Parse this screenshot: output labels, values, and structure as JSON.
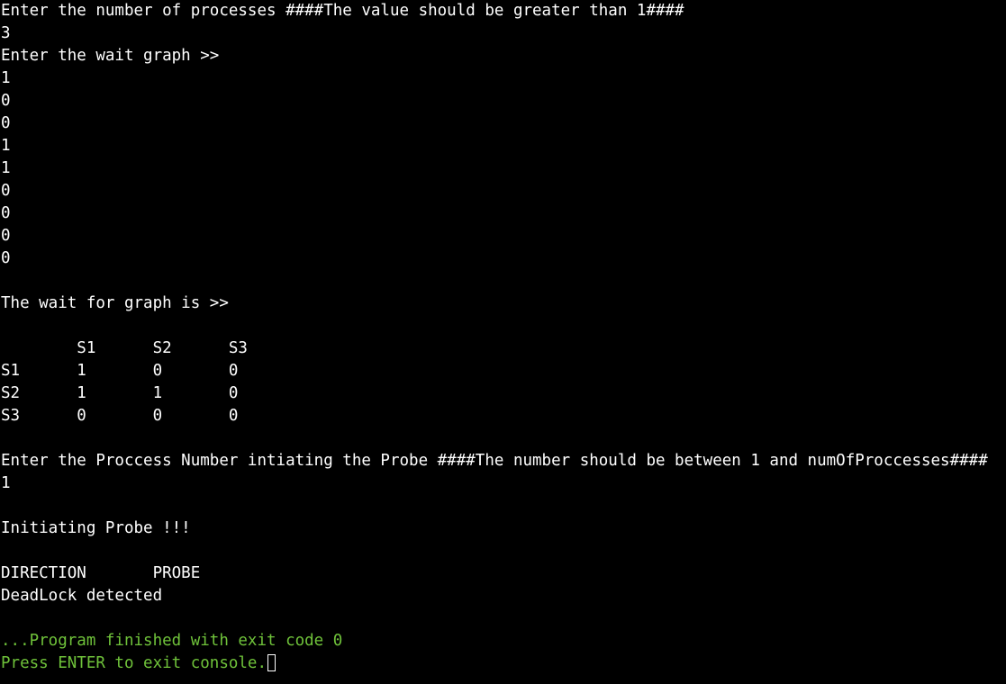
{
  "console": {
    "lines": [
      {
        "text": "Enter the number of processes ####The value should be greater than 1####",
        "kind": "output"
      },
      {
        "text": "3",
        "kind": "input"
      },
      {
        "text": "Enter the wait graph >>",
        "kind": "output"
      },
      {
        "text": "1",
        "kind": "input"
      },
      {
        "text": "0",
        "kind": "input"
      },
      {
        "text": "0",
        "kind": "input"
      },
      {
        "text": "1",
        "kind": "input"
      },
      {
        "text": "1",
        "kind": "input"
      },
      {
        "text": "0",
        "kind": "input"
      },
      {
        "text": "0",
        "kind": "input"
      },
      {
        "text": "0",
        "kind": "input"
      },
      {
        "text": "0",
        "kind": "input"
      },
      {
        "text": "",
        "kind": "blank"
      },
      {
        "text": "The wait for graph is >>",
        "kind": "output"
      },
      {
        "text": "",
        "kind": "blank"
      },
      {
        "text": "        S1      S2      S3",
        "kind": "output"
      },
      {
        "text": "S1      1       0       0",
        "kind": "output"
      },
      {
        "text": "S2      1       1       0",
        "kind": "output"
      },
      {
        "text": "S3      0       0       0",
        "kind": "output"
      },
      {
        "text": "",
        "kind": "blank"
      },
      {
        "text": "Enter the Proccess Number intiating the Probe ####The number should be between 1 and numOfProccesses####",
        "kind": "output"
      },
      {
        "text": "1",
        "kind": "input"
      },
      {
        "text": "",
        "kind": "blank"
      },
      {
        "text": "Initiating Probe !!!",
        "kind": "output"
      },
      {
        "text": "",
        "kind": "blank"
      },
      {
        "text": "DIRECTION       PROBE",
        "kind": "output"
      },
      {
        "text": "DeadLock detected",
        "kind": "output"
      },
      {
        "text": "",
        "kind": "blank"
      },
      {
        "text": "...Program finished with exit code 0",
        "kind": "status"
      },
      {
        "text": "Press ENTER to exit console.",
        "kind": "status"
      }
    ]
  },
  "colors": {
    "background": "#000000",
    "text": "#ffffff",
    "status": "#6fc23a"
  }
}
